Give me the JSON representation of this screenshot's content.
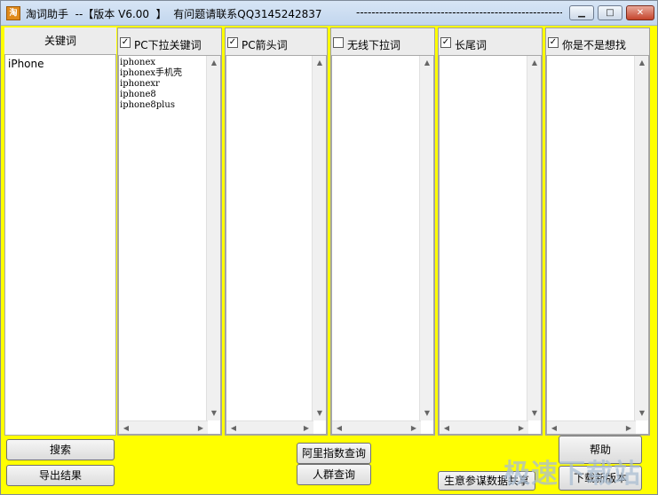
{
  "window": {
    "icon_label": "淘",
    "title": "淘词助手  --【版本 V6.00  】  有问题请联系QQ3145242837",
    "title_dashes": "-------------------------------------------------------------",
    "min_icon": "minimize-icon",
    "max_icon": "maximize-icon",
    "close_icon": "close-icon"
  },
  "keyword_panel": {
    "header": "关键词",
    "value": "iPhone"
  },
  "columns": [
    {
      "label": "PC下拉关键词",
      "checked": true,
      "items": [
        "iphonex",
        "iphonex手机壳",
        "iphonexr",
        "iphone8",
        "iphone8plus"
      ]
    },
    {
      "label": "PC箭头词",
      "checked": true,
      "items": []
    },
    {
      "label": "无线下拉词",
      "checked": false,
      "items": []
    },
    {
      "label": "长尾词",
      "checked": true,
      "items": []
    },
    {
      "label": "你是不是想找",
      "checked": true,
      "items": []
    }
  ],
  "buttons": {
    "search": "搜索",
    "export": "导出结果",
    "ali_index": "阿里指数查询",
    "crowd": "人群查询",
    "help": "帮助",
    "download": "下载新版本",
    "share": "生意参谋数据共享"
  },
  "watermark": "极速下载站"
}
